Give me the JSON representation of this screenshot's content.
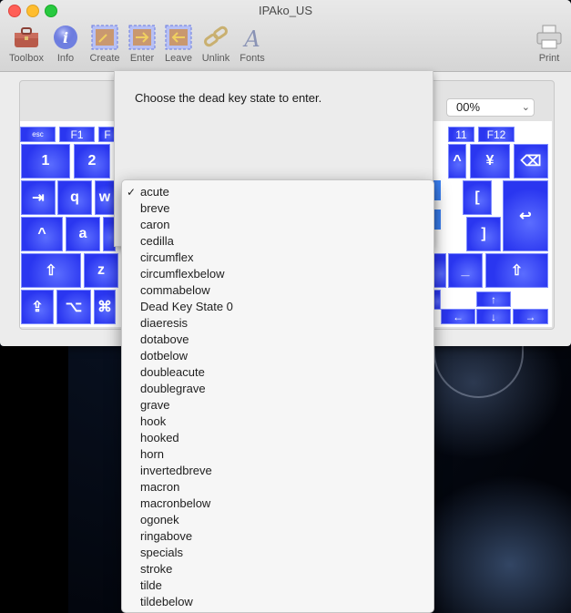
{
  "window": {
    "title": "IPAko_US"
  },
  "toolbar": [
    {
      "id": "toolbox",
      "label": "Toolbox",
      "icon": "toolbox-icon"
    },
    {
      "id": "info",
      "label": "Info",
      "icon": "info-icon"
    },
    {
      "id": "create",
      "label": "Create",
      "icon": "create-deadkey-icon"
    },
    {
      "id": "enter",
      "label": "Enter",
      "icon": "enter-deadkey-icon"
    },
    {
      "id": "leave",
      "label": "Leave",
      "icon": "leave-deadkey-icon"
    },
    {
      "id": "unlink",
      "label": "Unlink",
      "icon": "chain-link-icon"
    },
    {
      "id": "fonts",
      "label": "Fonts",
      "icon": "fonts-icon"
    },
    {
      "id": "print",
      "label": "Print",
      "icon": "printer-icon"
    }
  ],
  "zoom": {
    "value": "00%"
  },
  "keyboard": {
    "keys": {
      "esc": "esc",
      "f1": "F1",
      "f1_partial": "F",
      "f11": "11",
      "f12": "F12",
      "k1": "1",
      "k2": "2",
      "yen": "¥",
      "caret": "^",
      "q": "q",
      "w": "w",
      "bracket_open": "[",
      "bracket_close": "]",
      "a": "a",
      "z": "z",
      "underscore": "_",
      "caret_ctrl": "^",
      "up": "↑",
      "left": "←",
      "down": "↓",
      "right": "→",
      "option": "⌥",
      "command": "⌘",
      "shift_l": "⇧",
      "shift_r": "⇧",
      "shift_lock": "⇪",
      "tab": "⇥",
      "return": "↩",
      "delete": "⌫"
    }
  },
  "sheet": {
    "message": "Choose the dead key state to enter."
  },
  "menu": {
    "selected": "acute",
    "items": [
      "acute",
      "breve",
      "caron",
      "cedilla",
      "circumflex",
      "circumflexbelow",
      "commabelow",
      "Dead Key State 0",
      "diaeresis",
      "dotabove",
      "dotbelow",
      "doubleacute",
      "doublegrave",
      "grave",
      "hook",
      "hooked",
      "horn",
      "invertedbreve",
      "macron",
      "macronbelow",
      "ogonek",
      "ringabove",
      "specials",
      "stroke",
      "tilde",
      "tildebelow"
    ],
    "check_mark": "✓"
  }
}
